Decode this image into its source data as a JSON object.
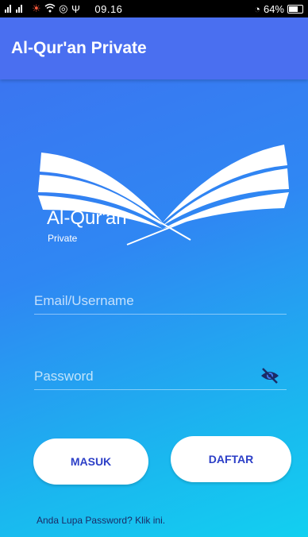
{
  "status_bar": {
    "signal_text": ".ıl",
    "time": "09.16",
    "battery": "64%",
    "icons": [
      "signal-icon",
      "wifi-icon",
      "usb-icon",
      "alarm-icon",
      "battery-icon"
    ]
  },
  "app_bar": {
    "title": "Al-Qur'an Private",
    "color": "#4a6ff0"
  },
  "logo": {
    "title": "Al-Qur'an",
    "subtitle": "Private"
  },
  "form": {
    "email": {
      "placeholder": "Email/Username",
      "value": ""
    },
    "password": {
      "placeholder": "Password",
      "value": ""
    }
  },
  "buttons": {
    "login_label": "MASUK",
    "register_label": "DAFTAR"
  },
  "forgot_link": "Anda Lupa Password? Klik ini.",
  "colors": {
    "gradient_start": "#3f6ff0",
    "gradient_end": "#12d0f0",
    "button_text": "#2c3fc7"
  }
}
